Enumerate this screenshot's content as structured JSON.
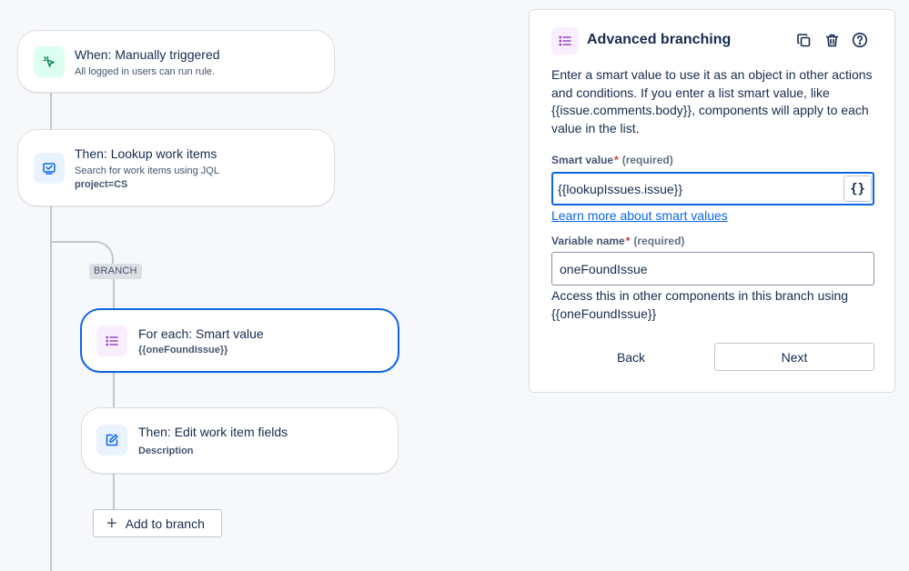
{
  "flow": {
    "trigger": {
      "title": "When: Manually triggered",
      "subtitle": "All logged in users can run rule."
    },
    "lookup": {
      "title": "Then: Lookup work items",
      "subtitle": "Search for work items using JQL",
      "query": "project=CS"
    },
    "branch_label": "BRANCH",
    "for_each": {
      "title": "For each: Smart value",
      "value": "{{oneFoundIssue}}"
    },
    "edit": {
      "title": "Then: Edit work item fields",
      "field": "Description"
    },
    "add_to_branch": "Add to branch"
  },
  "panel": {
    "title": "Advanced branching",
    "description": "Enter a smart value to use it as an object in other actions and conditions. If you enter a list smart value, like {{issue.comments.body}}, components will apply to each value in the list.",
    "smart_value": {
      "label": "Smart value",
      "required_marker": "*",
      "required_text": "(required)",
      "value": "{{lookupIssues.issue}}",
      "brace_label": "{}"
    },
    "learn_more": "Learn more about smart values",
    "variable_name": {
      "label": "Variable name",
      "required_marker": "*",
      "required_text": "(required)",
      "value": "oneFoundIssue"
    },
    "help_text": "Access this in other components in this branch using {{oneFoundIssue}}",
    "back_label": "Back",
    "next_label": "Next"
  },
  "colors": {
    "accent_blue": "#0c66e4",
    "trigger_icon_bg": "#dcfff1",
    "trigger_icon": "#1f845a",
    "action_icon_bg": "#e9f2ff",
    "action_icon": "#0c66e4",
    "branch_icon_bg": "#f8eefe",
    "branch_icon": "#964ac0"
  },
  "icons": {
    "trigger": "cursor-click-icon",
    "lookup": "search-list-icon",
    "for_each": "list-icon",
    "edit": "edit-icon",
    "add": "plus-icon",
    "copy": "copy-icon",
    "delete": "trash-icon",
    "help": "question-circle-icon"
  }
}
